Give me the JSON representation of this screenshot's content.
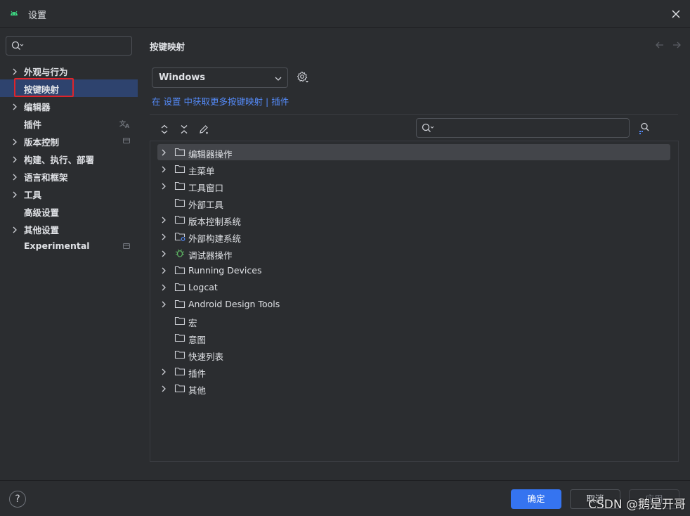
{
  "window": {
    "title": "设置"
  },
  "sidebar": {
    "search_placeholder": "",
    "items": [
      {
        "label": "外观与行为",
        "expandable": true
      },
      {
        "label": "按键映射",
        "expandable": false,
        "selected": true
      },
      {
        "label": "编辑器",
        "expandable": true
      },
      {
        "label": "插件",
        "expandable": false,
        "extra_icon": "translate-icon"
      },
      {
        "label": "版本控制",
        "expandable": true,
        "extra_icon": "project-icon"
      },
      {
        "label": "构建、执行、部署",
        "expandable": true
      },
      {
        "label": "语言和框架",
        "expandable": true
      },
      {
        "label": "工具",
        "expandable": true
      },
      {
        "label": "高级设置",
        "expandable": false
      },
      {
        "label": "其他设置",
        "expandable": true
      },
      {
        "label": "Experimental",
        "expandable": false,
        "extra_icon": "project-icon"
      }
    ]
  },
  "main": {
    "title": "按键映射",
    "keymap_value": "Windows",
    "hint": {
      "prefix": "在",
      "settings_link": "设置",
      "middle": "中获取更多按键映射",
      "separator": "|",
      "plugins_link": "插件"
    },
    "action_search_placeholder": "",
    "actions": [
      {
        "label": "编辑器操作",
        "expandable": true,
        "icon": "folder-icon",
        "selected": true
      },
      {
        "label": "主菜单",
        "expandable": true,
        "icon": "folder-icon"
      },
      {
        "label": "工具窗口",
        "expandable": true,
        "icon": "folder-icon"
      },
      {
        "label": "外部工具",
        "expandable": false,
        "icon": "folder-icon"
      },
      {
        "label": "版本控制系统",
        "expandable": true,
        "icon": "folder-icon"
      },
      {
        "label": "外部构建系统",
        "expandable": true,
        "icon": "folder-gear-icon"
      },
      {
        "label": "调试器操作",
        "expandable": true,
        "icon": "bug-icon"
      },
      {
        "label": "Running Devices",
        "expandable": true,
        "icon": "folder-icon"
      },
      {
        "label": "Logcat",
        "expandable": true,
        "icon": "folder-icon"
      },
      {
        "label": "Android Design Tools",
        "expandable": true,
        "icon": "folder-icon"
      },
      {
        "label": "宏",
        "expandable": false,
        "icon": "folder-icon"
      },
      {
        "label": "意图",
        "expandable": false,
        "icon": "folder-icon"
      },
      {
        "label": "快速列表",
        "expandable": false,
        "icon": "folder-icon"
      },
      {
        "label": "插件",
        "expandable": true,
        "icon": "folder-icon"
      },
      {
        "label": "其他",
        "expandable": true,
        "icon": "folder-icon"
      }
    ]
  },
  "footer": {
    "help": "?",
    "ok_label": "确定",
    "cancel_label": "取消",
    "apply_label": "应用"
  },
  "watermark": "CSDN @鹅是开哥",
  "colors": {
    "accent": "#3574f0",
    "link": "#548af7",
    "selection": "#2e436e",
    "highlight": "#e0242a"
  }
}
